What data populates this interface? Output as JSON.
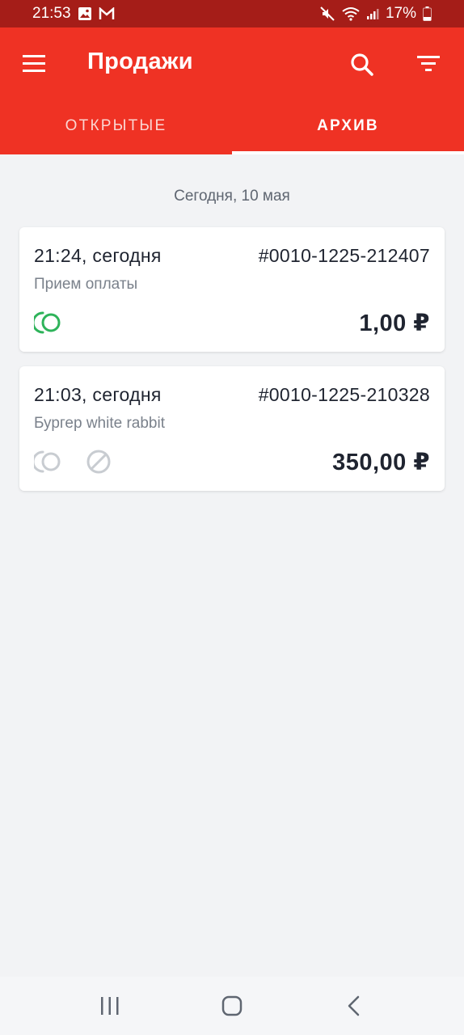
{
  "status_bar": {
    "time": "21:53",
    "battery": "17%",
    "left_icons": [
      "gallery-icon",
      "gmail-icon"
    ],
    "right_icons": [
      "mute-icon",
      "wifi-icon",
      "signal-icon",
      "battery-icon"
    ]
  },
  "app_bar": {
    "title": "Продажи",
    "background": "#ef3224",
    "icons": [
      "menu-icon",
      "search-icon",
      "filter-icon"
    ]
  },
  "tabs": [
    {
      "label": "ОТКРЫТЫЕ",
      "selected": false
    },
    {
      "label": "АРХИВ",
      "selected": true
    }
  ],
  "list": {
    "date_header": "Сегодня, 10 мая",
    "sales": [
      {
        "time": "21:24, сегодня",
        "number": "#0010-1225-212407",
        "description": "Прием оплаты",
        "amount": "1,00 ₽",
        "status_icons": [
          "payment-status-icon-active"
        ]
      },
      {
        "time": "21:03, сегодня",
        "number": "#0010-1225-210328",
        "description": "Бургер white rabbit",
        "amount": "350,00 ₽",
        "status_icons": [
          "payment-status-icon-inactive",
          "cancelled-icon"
        ]
      }
    ]
  },
  "nav_bar": {
    "icons": [
      "recent-apps-icon",
      "home-icon",
      "back-icon"
    ]
  },
  "colors": {
    "accent": "#ef3224",
    "status_bar": "#a51d18",
    "success": "#2eb35a",
    "inactive": "#c8ccd1"
  }
}
